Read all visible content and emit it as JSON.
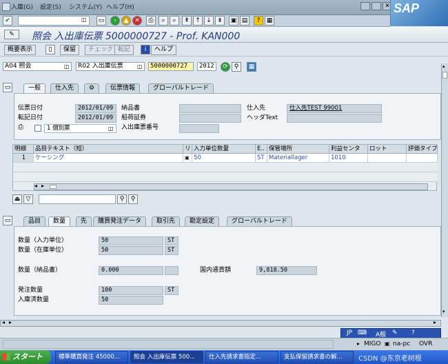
{
  "menu": [
    "入庫(G)",
    "設定(S)",
    "システム(Y)",
    "ヘルプ(H)"
  ],
  "brand": "SAP",
  "title": "照会 入出庫伝票 5000000727 - Prof. KAN000",
  "app_toolbar": {
    "overview": "概要表示",
    "hold": "保留",
    "check": "チェック",
    "post": "転記",
    "help": "ヘルプ"
  },
  "selection": {
    "action": "A04 照会",
    "ref_doc": "R02 入出庫伝票",
    "doc_no": "5000000727",
    "year": "2012"
  },
  "header_tabs": [
    "一般",
    "仕入先",
    "",
    "伝票情報",
    "グローバルトレード"
  ],
  "general": {
    "doc_date_label": "伝票日付",
    "doc_date": "2012/01/09",
    "post_date_label": "転記日付",
    "post_date": "2012/01/09",
    "slip_type": "1 個別票",
    "delivery_note_label": "納品書",
    "bill_of_lading_label": "船荷証券",
    "mat_slip_label": "入出庫票番号",
    "vendor_label": "仕入先",
    "vendor": "仕入先TEST 99001",
    "header_text_label": "ヘッダText"
  },
  "grid": {
    "columns": [
      "明細",
      "品目テキスト（短）",
      "リ",
      "入力単位数量",
      "E..",
      "保管場所",
      "利益センタ",
      "ロット",
      "評価タイプ"
    ],
    "rows": [
      [
        "1",
        "ケーシング",
        "",
        "50",
        "ST",
        "Materiallager",
        "1010",
        "",
        ""
      ]
    ]
  },
  "item_tabs": [
    "品目",
    "数量",
    "先",
    "購買発注データ",
    "取引先",
    "勘定設定",
    "グローバルトレード"
  ],
  "qty": {
    "entry_label": "数量（入力単位）",
    "entry": "50",
    "entry_unit": "ST",
    "stock_label": "数量（在庫単位）",
    "stock": "50",
    "stock_unit": "ST",
    "dn_label": "数量（納品書）",
    "dn": "0.000",
    "local_amt_label": "国内通貨額",
    "local_amt": "9,818.50",
    "ordered_label": "発注数量",
    "ordered": "100",
    "ordered_unit": "ST",
    "received_label": "入庫済数量",
    "received": "50"
  },
  "status": {
    "lang": "JP",
    "ime": "A般",
    "tx": "MIGO",
    "server": "na-pc",
    "mode": "OVR"
  },
  "taskbar": {
    "start": "スタート",
    "items": [
      "標準購買発注 45000...",
      "照会 入出庫伝票 500...",
      "仕入先請求書指定...",
      "支払保留請求書の解..."
    ],
    "watermark": "CSDN @东京老树根"
  }
}
